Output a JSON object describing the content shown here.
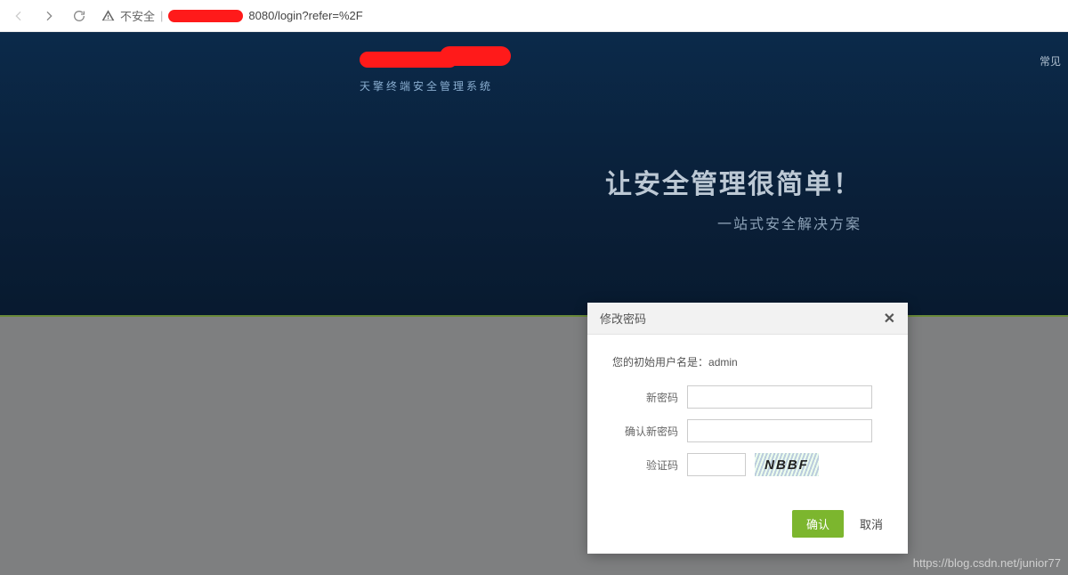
{
  "browser": {
    "insecure_label": "不安全",
    "url_suffix": "8080/login?refer=%2F"
  },
  "hero": {
    "brand_subtitle": "天擎终端安全管理系统",
    "headline": "让安全管理很简单！",
    "subhead": "一站式安全解决方案",
    "top_link": "常见"
  },
  "modal": {
    "title": "修改密码",
    "init_user_prefix": "您的初始用户名是：",
    "init_user_value": "admin",
    "label_new_password": "新密码",
    "label_confirm_password": "确认新密码",
    "label_captcha": "验证码",
    "captcha_text": "NBBF",
    "confirm": "确认",
    "cancel": "取消"
  },
  "watermark": "https://blog.csdn.net/junior77"
}
